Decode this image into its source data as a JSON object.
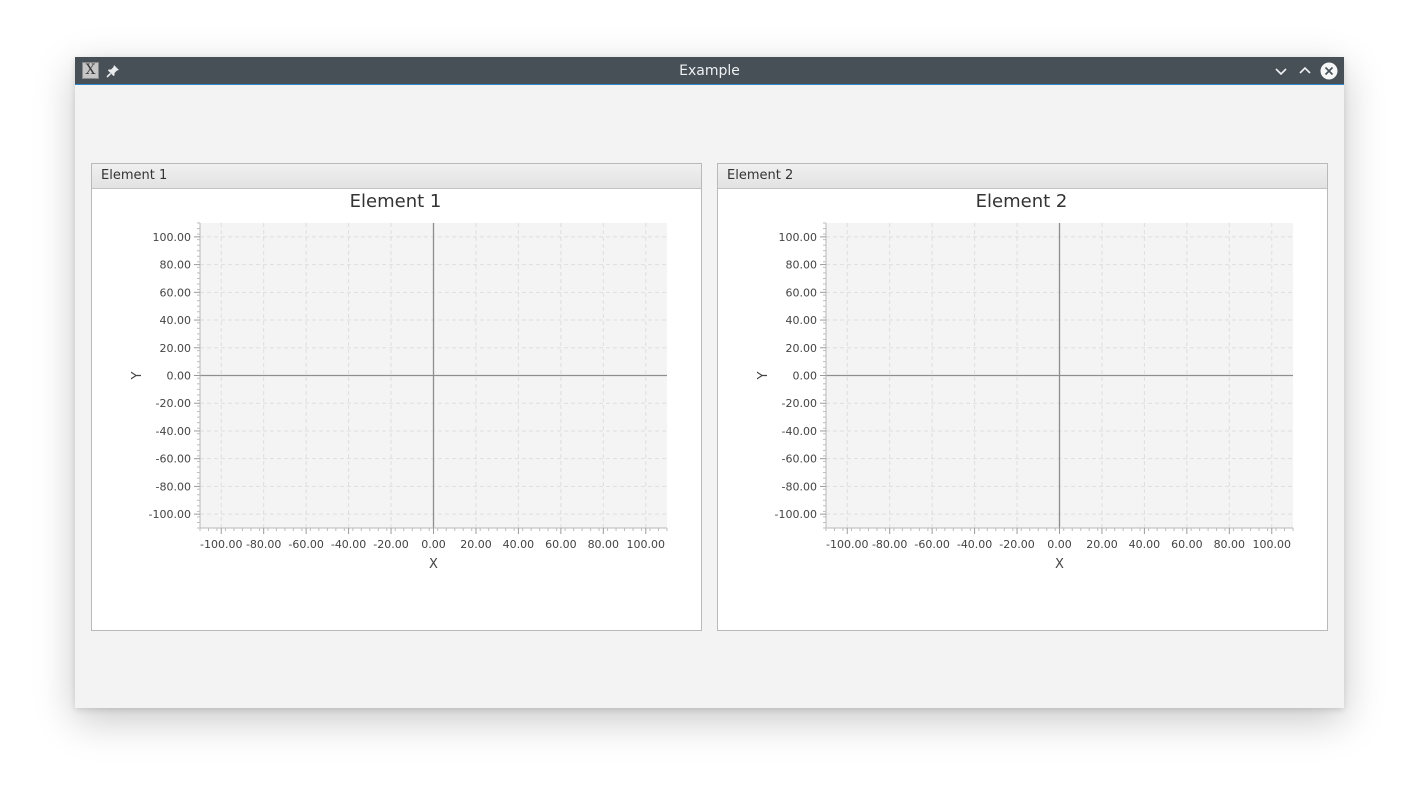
{
  "window": {
    "title": "Example",
    "app_icon": "X"
  },
  "panels": [
    {
      "header": "Element 1"
    },
    {
      "header": "Element 2"
    }
  ],
  "colors": {
    "titlebar": "#475057",
    "titlebar_accent": "#2f86c9",
    "plot_background": "#f4f4f4",
    "axis_line": "#8e8e8e"
  },
  "chart_data": [
    {
      "type": "scatter",
      "title": "Element 1",
      "xlabel": "X",
      "ylabel": "Y",
      "xlim": [
        -110,
        110
      ],
      "ylim": [
        -110,
        110
      ],
      "x_ticks": [
        "-100.00",
        "-80.00",
        "-60.00",
        "-40.00",
        "-20.00",
        "0.00",
        "20.00",
        "40.00",
        "60.00",
        "80.00",
        "100.00"
      ],
      "y_ticks": [
        "100.00",
        "80.00",
        "60.00",
        "40.00",
        "20.00",
        "0.00",
        "-20.00",
        "-40.00",
        "-60.00",
        "-80.00",
        "-100.00"
      ],
      "series": [],
      "grid": true
    },
    {
      "type": "scatter",
      "title": "Element 2",
      "xlabel": "X",
      "ylabel": "Y",
      "xlim": [
        -110,
        110
      ],
      "ylim": [
        -110,
        110
      ],
      "x_ticks": [
        "-100.00",
        "-80.00",
        "-60.00",
        "-40.00",
        "-20.00",
        "0.00",
        "20.00",
        "40.00",
        "60.00",
        "80.00",
        "100.00"
      ],
      "y_ticks": [
        "100.00",
        "80.00",
        "60.00",
        "40.00",
        "20.00",
        "0.00",
        "-20.00",
        "-40.00",
        "-60.00",
        "-80.00",
        "-100.00"
      ],
      "series": [],
      "grid": true
    }
  ]
}
